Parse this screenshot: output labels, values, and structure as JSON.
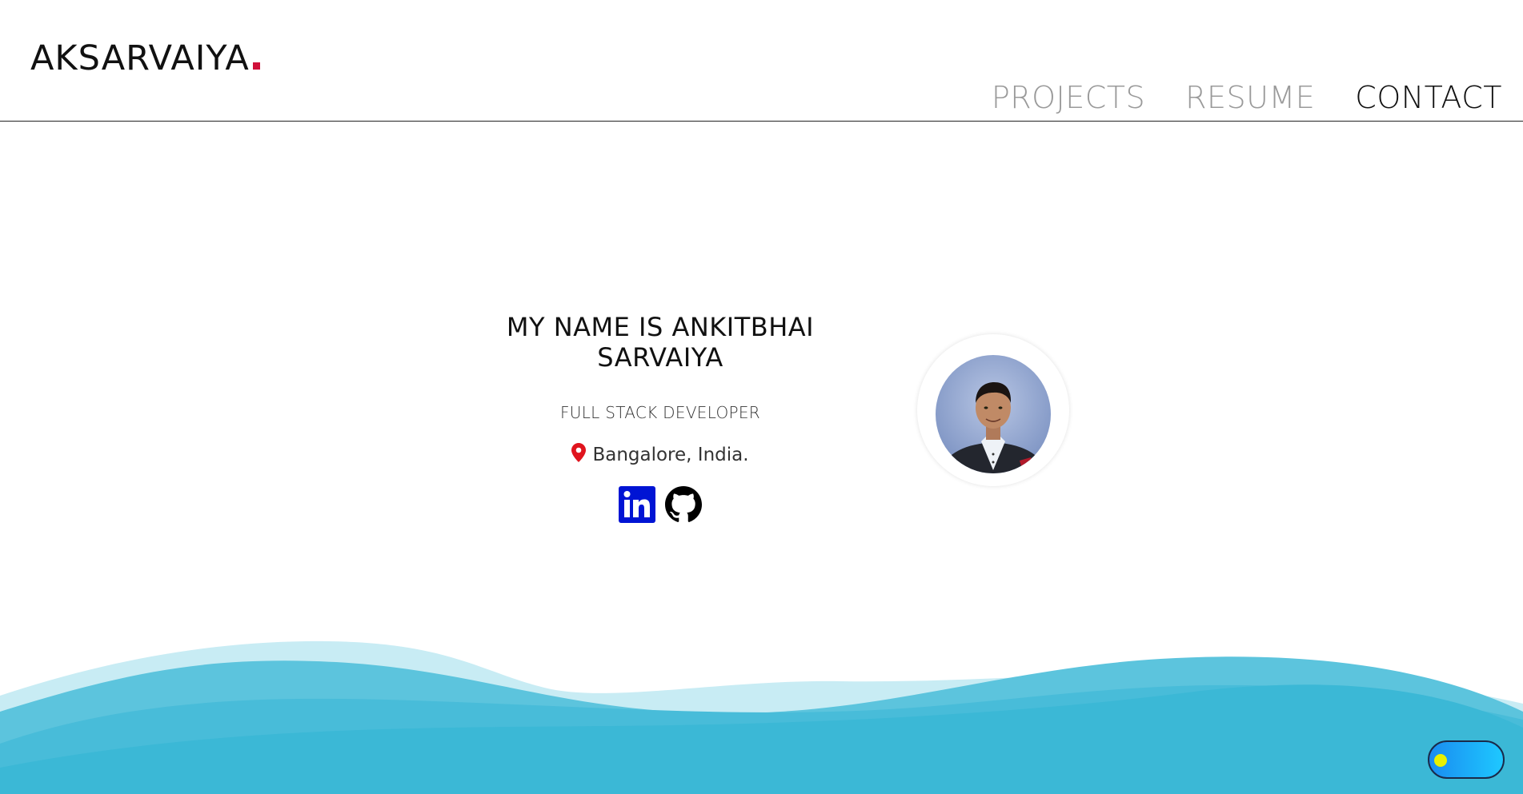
{
  "header": {
    "logo_text": "AKSARVAIYA",
    "logo_dot_color": "#d0103a",
    "nav": [
      {
        "label": "PROJECTS",
        "active": false
      },
      {
        "label": "RESUME",
        "active": false
      },
      {
        "label": "CONTACT",
        "active": true
      }
    ]
  },
  "hero": {
    "title": "MY NAME IS ANKITBHAI SARVAIYA",
    "role": "FULL STACK DEVELOPER",
    "location": "Bangalore, India.",
    "location_icon": "map-pin-icon",
    "socials": [
      {
        "icon": "linkedin-icon",
        "color": "#0014d4"
      },
      {
        "icon": "github-icon",
        "color": "#000000"
      }
    ],
    "avatar": "profile-photo"
  },
  "theme_toggle": {
    "state": "off",
    "knob_color": "#e8f000",
    "track_color": "#1a8cf0"
  },
  "colors": {
    "wave_primary": "#3bb8d6",
    "wave_light": "#c8ecf4",
    "active_nav": "#111111",
    "inactive_nav": "#9a9a9a"
  }
}
